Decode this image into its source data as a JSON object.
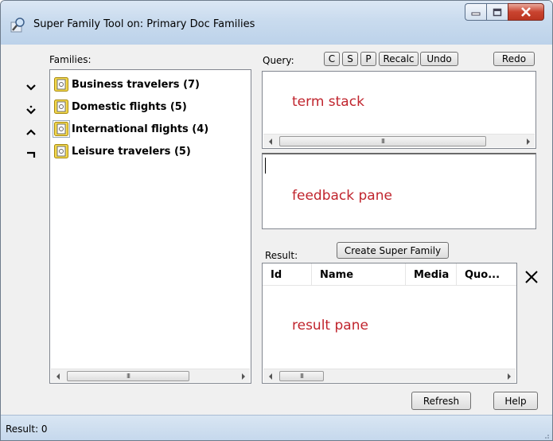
{
  "window": {
    "title": "Super Family Tool on: Primary Doc Families",
    "icon": "search-magnifier-icon"
  },
  "families": {
    "label": "Families:",
    "items": [
      {
        "label": "Business travelers (7)"
      },
      {
        "label": "Domestic flights (5)"
      },
      {
        "label": "International flights (4)"
      },
      {
        "label": "Leisure travelers (5)"
      }
    ],
    "operators": [
      "chevron-down-icon",
      "chevron-down-dot-icon",
      "chevron-up-icon",
      "not-operator-icon"
    ]
  },
  "query": {
    "label": "Query:",
    "buttons": {
      "c": "C",
      "s": "S",
      "p": "P",
      "recalc": "Recalc",
      "undo": "Undo",
      "redo": "Redo"
    },
    "term_stack_caption": "term stack",
    "feedback_caption": "feedback pane"
  },
  "result": {
    "label": "Result:",
    "create_button": "Create Super Family",
    "columns": [
      "Id",
      "Name",
      "Media",
      "Quo..."
    ],
    "pane_caption": "result pane",
    "clear_icon": "close-x-icon"
  },
  "footer": {
    "refresh": "Refresh",
    "help": "Help"
  },
  "status": {
    "text": "Result: 0"
  },
  "scroll_glyph": "III",
  "colors": {
    "caption_red": "#c0242d",
    "titlebar": "#c9dbee",
    "close_button": "#c9432f"
  }
}
